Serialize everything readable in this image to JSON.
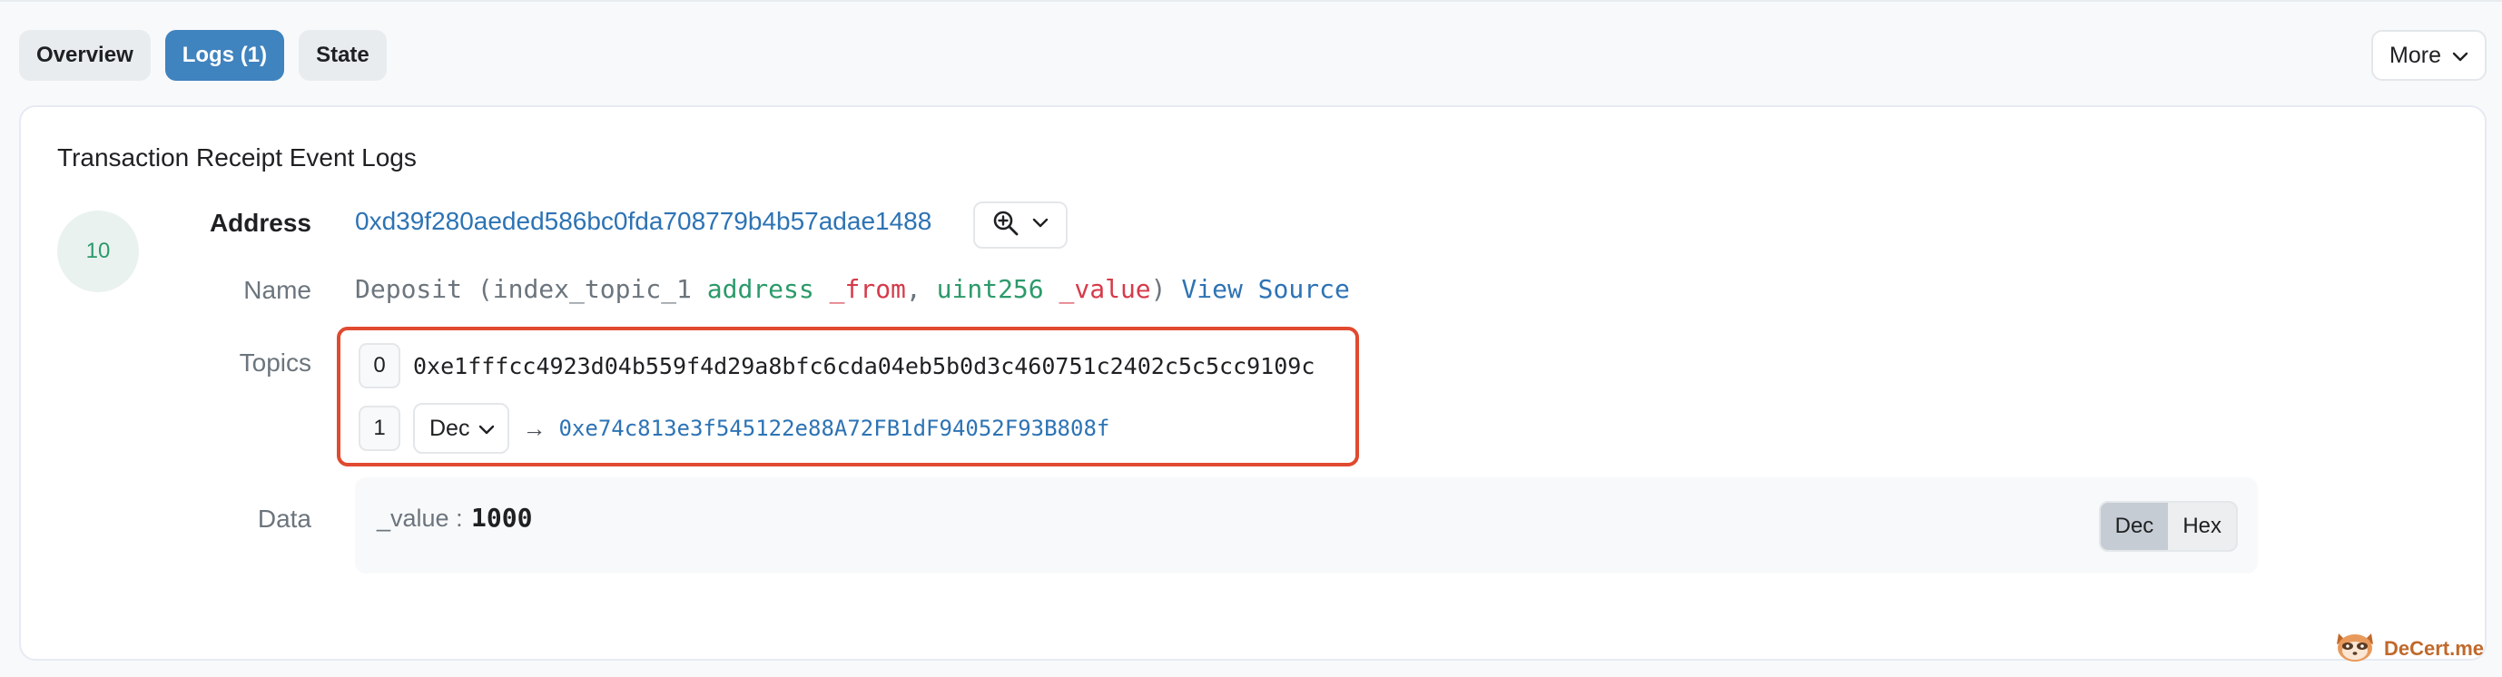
{
  "tabs": [
    {
      "label": "Overview",
      "active": false
    },
    {
      "label": "Logs (1)",
      "active": true
    },
    {
      "label": "State",
      "active": false
    }
  ],
  "more_label": "More",
  "card": {
    "title": "Transaction Receipt Event Logs",
    "log_index": "10",
    "address": {
      "label": "Address",
      "value": "0xd39f280aeded586bc0fda708779b4b57adae1488"
    },
    "name": {
      "label": "Name",
      "event": "Deposit",
      "open": " (",
      "p1_prefix": "index_topic_1 ",
      "p1_type": "address",
      "p1_name": "_from",
      "sep": ", ",
      "p2_type": "uint256",
      "p2_name": "_value",
      "close": ")",
      "view_source": "View Source"
    },
    "topics": {
      "label": "Topics",
      "items": [
        {
          "index": "0",
          "value": "0xe1fffcc4923d04b559f4d29a8bfc6cda04eb5b0d3c460751c2402c5c5cc9109c"
        },
        {
          "index": "1",
          "format": "Dec",
          "arrow": "→",
          "value": "0xe74c813e3f545122e88A72FB1dF94052F93B808f"
        }
      ]
    },
    "data": {
      "label": "Data",
      "key": "_value :",
      "value": "1000",
      "toggle": [
        "Dec",
        "Hex"
      ],
      "toggle_active": "Dec"
    }
  },
  "watermark": "DeCert.me",
  "colors": {
    "accent": "#3f83bf",
    "link": "#2d73b4",
    "type": "#2c9a6a",
    "param": "#d63a4a",
    "highlight": "#e04a2f"
  }
}
